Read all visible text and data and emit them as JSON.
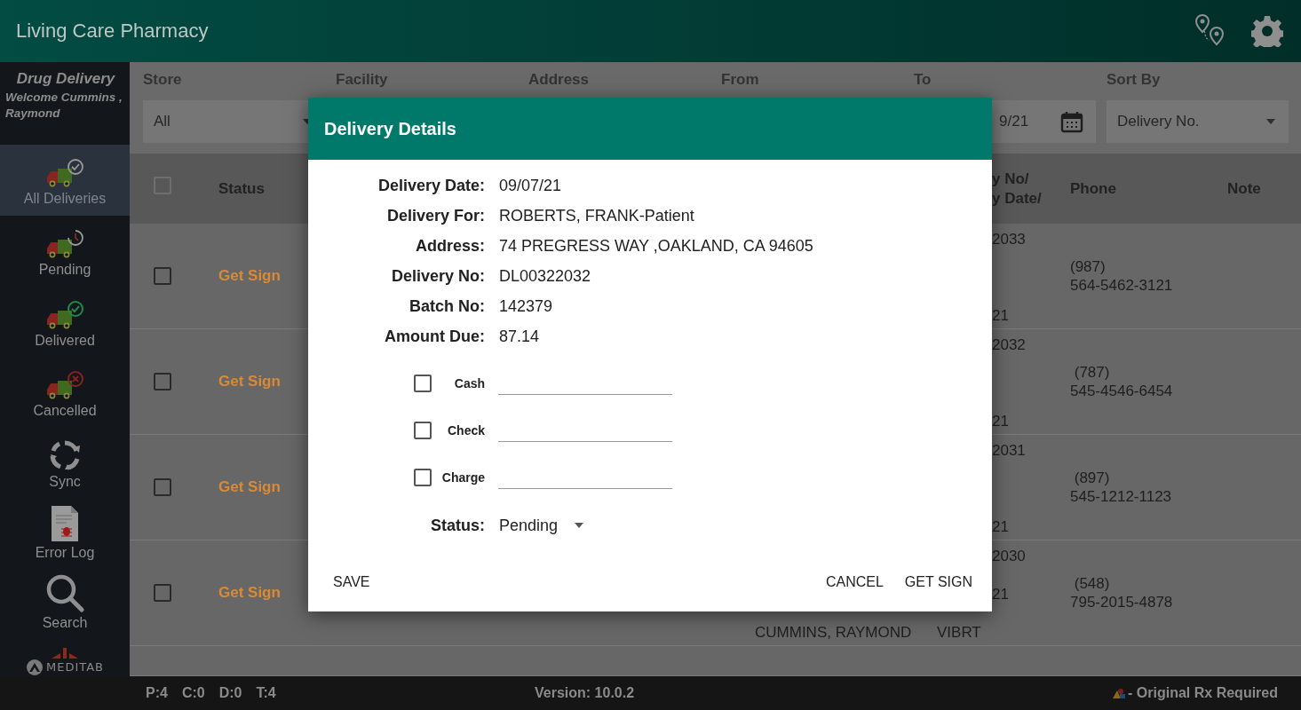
{
  "app_bar": {
    "title": "Living Care Pharmacy"
  },
  "sidebar": {
    "title": "Drug Delivery",
    "welcome": "Welcome Cummins , Raymond",
    "items": [
      {
        "kind": "all",
        "label": "All Deliveries",
        "selected": true
      },
      {
        "kind": "pending",
        "label": "Pending",
        "selected": false
      },
      {
        "kind": "delivered",
        "label": "Delivered",
        "selected": false
      },
      {
        "kind": "cancelled",
        "label": "Cancelled",
        "selected": false
      },
      {
        "kind": "sync",
        "label": "Sync",
        "selected": false
      },
      {
        "kind": "error_log",
        "label": "Error Log",
        "selected": false
      },
      {
        "kind": "search",
        "label": "Search",
        "selected": false
      }
    ],
    "logo": "MEDITAB"
  },
  "filters": [
    {
      "kind": "dropdown",
      "label": "Store",
      "value": "All"
    },
    {
      "kind": "hidden",
      "label": "Facility"
    },
    {
      "kind": "hidden",
      "label": "Address"
    },
    {
      "kind": "hidden",
      "label": "From"
    },
    {
      "kind": "date",
      "label": "To",
      "value": "9/21"
    },
    {
      "kind": "dropdown",
      "label": "Sort By",
      "value": "Delivery No."
    }
  ],
  "table": {
    "header_checked": false,
    "columns": {
      "status": "Status",
      "column_5": [
        "y No/",
        "y Date/"
      ],
      "phone": "Phone",
      "note": "Note"
    },
    "rows": [
      {
        "checked": false,
        "status": "Get Sign",
        "column_5": [
          "2033",
          "21"
        ],
        "phone": [
          "(987)",
          "564-5462-3121"
        ]
      },
      {
        "checked": false,
        "status": "Get Sign",
        "column_5": [
          "2032",
          "21"
        ],
        "phone": [
          " (787)",
          "545-4546-6454"
        ]
      },
      {
        "checked": false,
        "status": "Get Sign",
        "column_5": [
          "2031",
          "21"
        ],
        "phone": [
          " (897)",
          "545-1212-1123"
        ]
      },
      {
        "checked": false,
        "status": "Get Sign",
        "column_4": "CUMMINS, RAYMOND",
        "column_5": [
          "2030",
          "21",
          "VIBRT"
        ],
        "phone": [
          " (548)",
          "795-2015-4878"
        ]
      }
    ]
  },
  "dialog": {
    "title": "Delivery Details",
    "details": [
      {
        "label": "Delivery Date:",
        "value": "09/07/21"
      },
      {
        "label": "Delivery For:",
        "value": "ROBERTS, FRANK-Patient"
      },
      {
        "label": "Address:",
        "value": "74 PREGRESS WAY ,OAKLAND, CA 94605"
      },
      {
        "label": "Delivery No:",
        "value": "DL00322032"
      },
      {
        "label": "Batch No:",
        "value": "142379"
      },
      {
        "label": "Amount Due:",
        "value": "87.14"
      }
    ],
    "payments": [
      {
        "label": "Cash",
        "checked": false
      },
      {
        "label": "Check",
        "checked": false
      },
      {
        "label": "Charge",
        "checked": false
      }
    ],
    "status": {
      "label": "Status:",
      "value": "Pending"
    },
    "left_buttons": [
      "SAVE"
    ],
    "right_buttons": [
      "CANCEL",
      "GET SIGN"
    ]
  },
  "status_bar": {
    "counts": [
      "P:4",
      "C:0",
      "D:0",
      "T:4"
    ],
    "version": "Version: 10.0.2",
    "legend": "- Original Rx Required"
  }
}
